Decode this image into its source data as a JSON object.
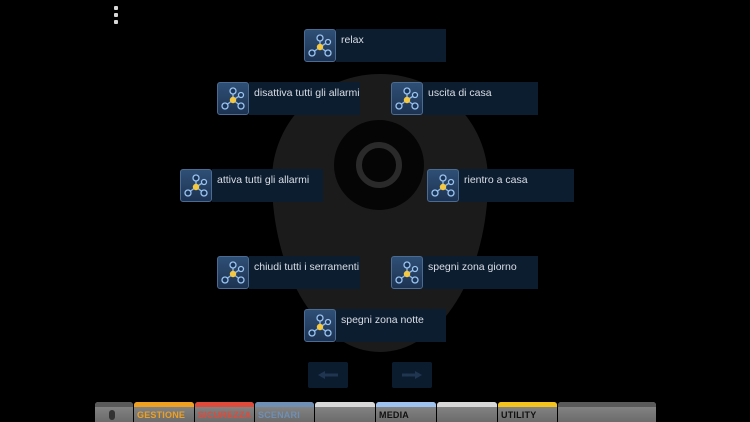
{
  "scenes": [
    {
      "label": "relax"
    },
    {
      "label": "disattiva tutti gli allarmi"
    },
    {
      "label": "uscita di casa"
    },
    {
      "label": "attiva tutti gli allarmi"
    },
    {
      "label": "rientro a casa"
    },
    {
      "label": "chiudi tutti i serramenti"
    },
    {
      "label": "spegni zona giorno"
    },
    {
      "label": "spegni zona notte"
    }
  ],
  "tabs": [
    {
      "label": "",
      "icon": "mouse-icon",
      "color": "#5a5a5a"
    },
    {
      "label": "GESTIONE",
      "color": "#f0a020"
    },
    {
      "label": "SICUREZZA",
      "color": "#e04a3a"
    },
    {
      "label": "SCENARI",
      "color": "#6f8fb5"
    },
    {
      "label": "",
      "color": "#d8d8d8"
    },
    {
      "label": "MEDIA",
      "color": "#9fc3f0"
    },
    {
      "label": "",
      "color": "#d8d8d8"
    },
    {
      "label": "UTILITY",
      "color": "#f3c21c"
    },
    {
      "label": "",
      "color": "#5a5a5a"
    }
  ],
  "icons": {
    "menu": "more-vertical-icon",
    "scene": "scene-network-icon",
    "prev": "arrow-left-icon",
    "next": "arrow-right-icon"
  }
}
